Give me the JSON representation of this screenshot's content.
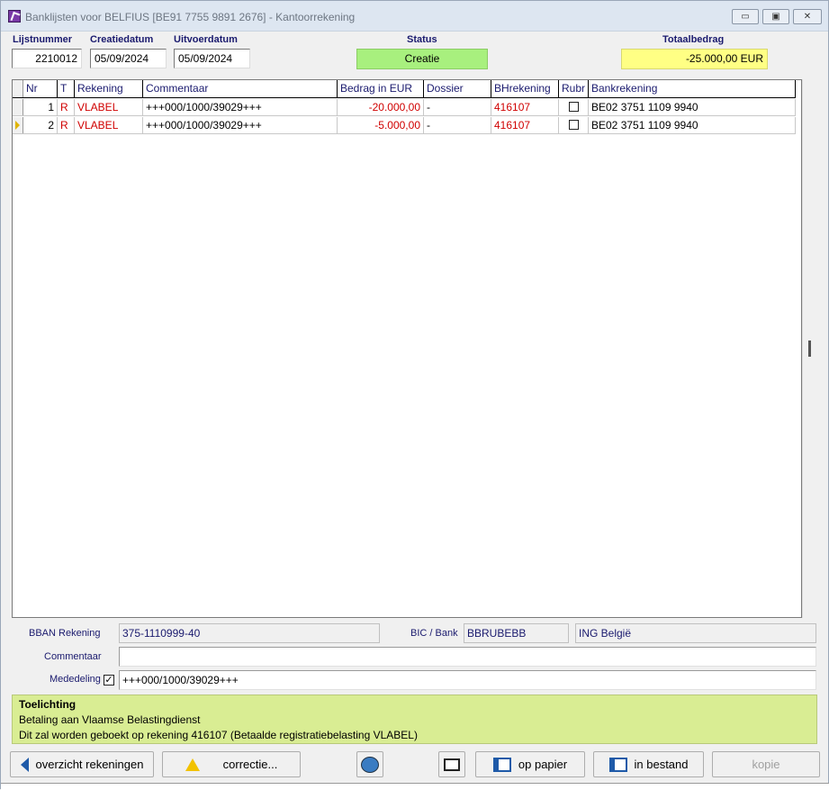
{
  "window": {
    "title": "Banklijsten voor BELFIUS [BE91 7755 9891 2676] - Kantoorrekening",
    "buttons": {
      "minimize": "▭",
      "maximize": "▣",
      "close": "✕"
    }
  },
  "header": {
    "lijstnummer_label": "Lijstnummer",
    "lijstnummer_value": "2210012",
    "creatiedatum_label": "Creatiedatum",
    "creatiedatum_value": "05/09/2024",
    "uitvoerdatum_label": "Uitvoerdatum",
    "uitvoerdatum_value": "05/09/2024",
    "status_label": "Status",
    "status_value": "Creatie",
    "totaal_label": "Totaalbedrag",
    "totaal_value": "-25.000,00  EUR"
  },
  "colors": {
    "status_bg": "#a8f07e",
    "total_bg": "#ffff84",
    "toelichting_bg": "#d9ed93",
    "accent_red": "#d00000"
  },
  "grid": {
    "columns": [
      "Nr",
      "T",
      "Rekening",
      "Commentaar",
      "Bedrag in EUR",
      "Dossier",
      "BHrekening",
      "Rubr",
      "Bankrekening"
    ],
    "rows": [
      {
        "nr": "1",
        "t": "R",
        "rekening": "VLABEL",
        "commentaar": "+++000/1000/39029+++",
        "bedrag": "-20.000,00",
        "dossier": "-",
        "bhrekening": "416107",
        "rubr": false,
        "bankrekening": "BE02 3751 1109 9940"
      },
      {
        "nr": "2",
        "t": "R",
        "rekening": "VLABEL",
        "commentaar": "+++000/1000/39029+++",
        "bedrag": "-5.000,00",
        "dossier": "-",
        "bhrekening": "416107",
        "rubr": false,
        "bankrekening": "BE02 3751 1109 9940"
      }
    ]
  },
  "detail": {
    "bban_label": "BBAN Rekening",
    "bban_value": "375-1110999-40",
    "bic_label": "BIC / Bank",
    "bic_value": "BBRUBEBB",
    "bank_name": "ING België",
    "commentaar_label": "Commentaar",
    "commentaar_value": "",
    "mededeling_label": "Mededeling",
    "mededeling_checked": "✓",
    "mededeling_value": "+++000/1000/39029+++"
  },
  "toelichting": {
    "title": "Toelichting",
    "line1": "Betaling aan Vlaamse Belastingdienst",
    "line2": "Dit zal worden geboekt op rekening 416107 (Betaalde registratiebelasting VLABEL)"
  },
  "buttons": {
    "overzicht": "overzicht rekeningen",
    "correctie": "correctie...",
    "op_papier": "op papier",
    "in_bestand": "in bestand",
    "kopie": "kopie"
  },
  "icons": {
    "back": "left-arrow-icon",
    "warning": "warning-icon",
    "globe": "globe-icon",
    "printer": "printer-icon",
    "export_papier": "export-icon",
    "export_bestand": "export-file-icon"
  }
}
